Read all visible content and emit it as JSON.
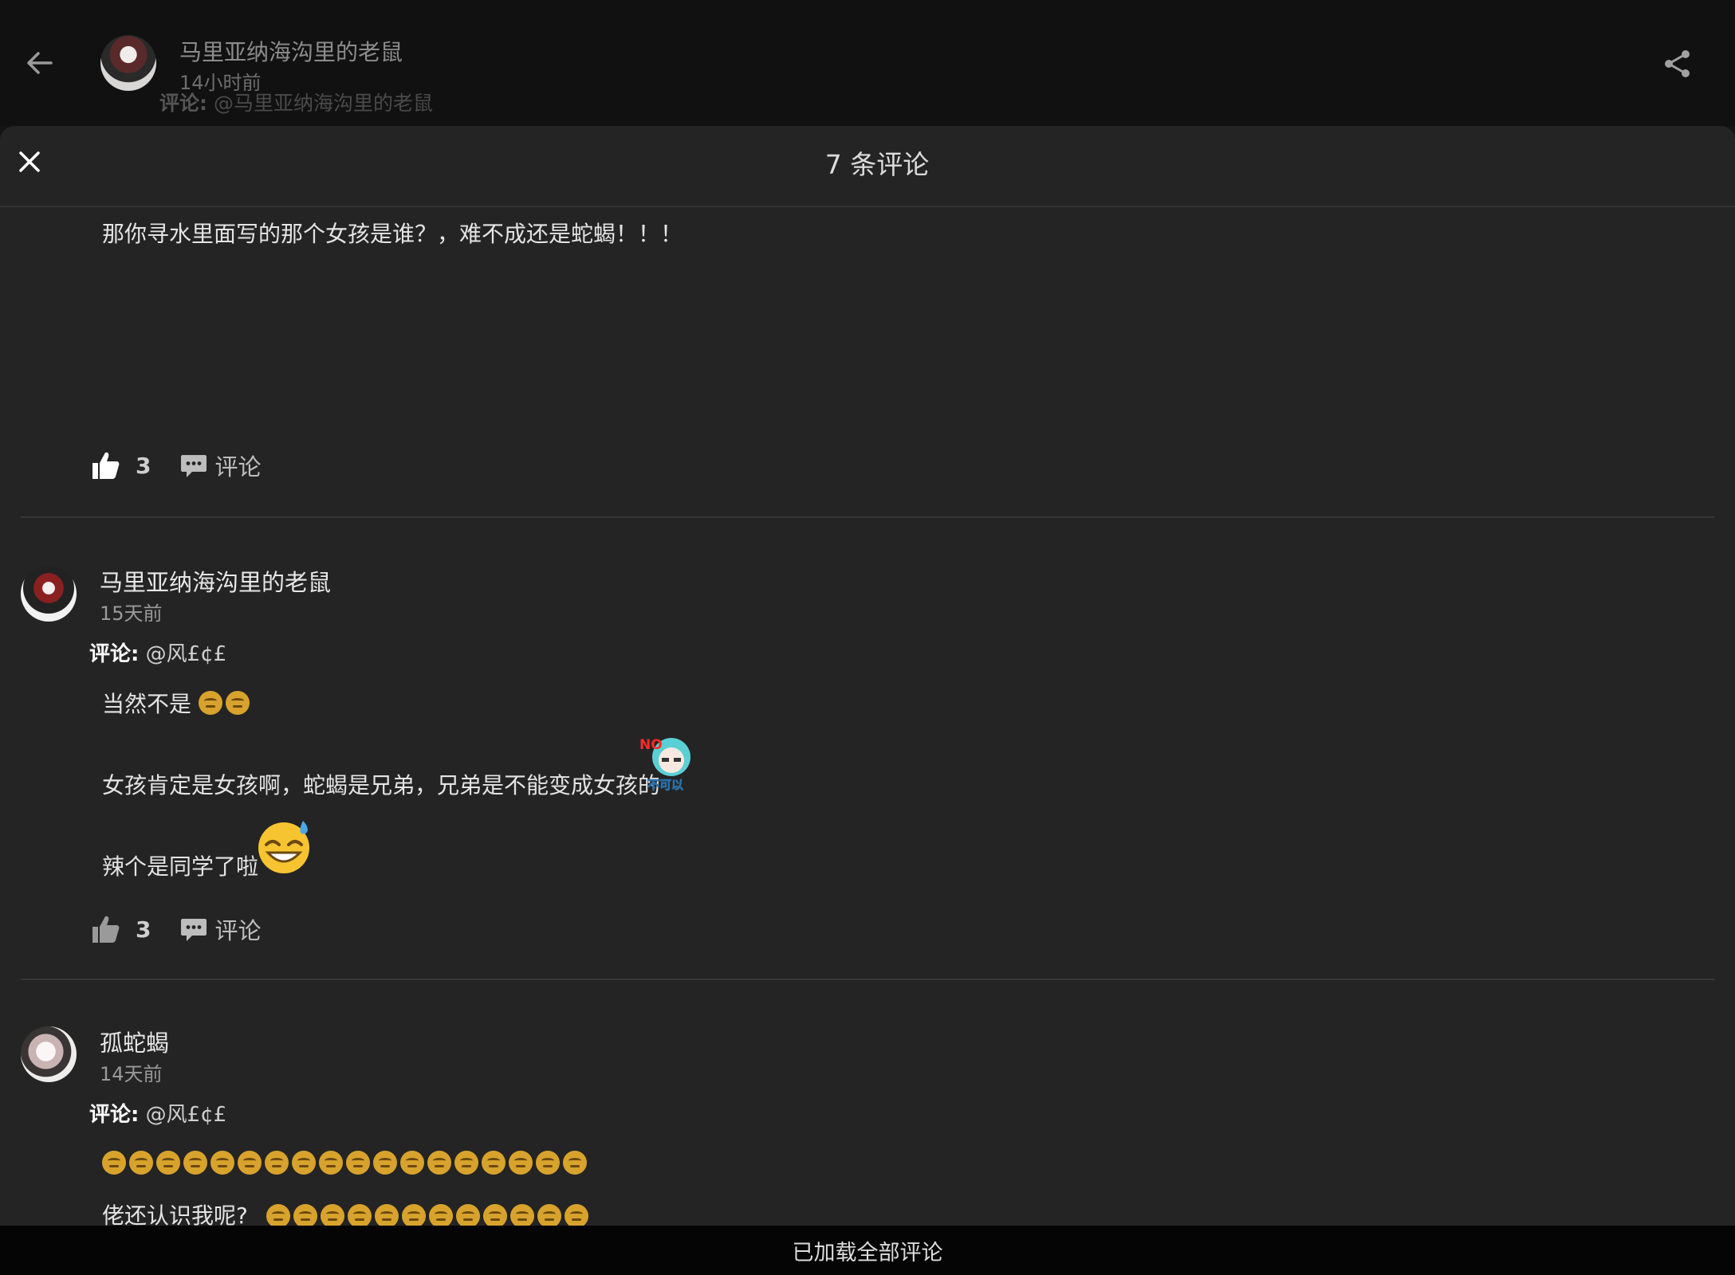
{
  "topbar": {
    "author_name": "马里亚纳海沟里的老鼠",
    "time": "14小时前",
    "sub_prefix": "评论:",
    "sub_mention": "@马里亚纳海沟里的老鼠"
  },
  "sheet": {
    "title": "7 条评论"
  },
  "comment1": {
    "text": "那你寻水里面写的那个女孩是谁？，难不成还是蛇蝎！！！",
    "likes": "3",
    "reply_label": "评论"
  },
  "comment2": {
    "author": "马里亚纳海沟里的老鼠",
    "time": "15天前",
    "reply_prefix": "评论:",
    "reply_mention": "@风£¢£",
    "line1": "当然不是",
    "line2": "女孩肯定是女孩啊，蛇蝎是兄弟，兄弟是不能变成女孩的",
    "line3": "辣个是同学了啦",
    "sticker_no": "NO",
    "sticker_text": "不可以",
    "likes": "3",
    "reply_label": "评论"
  },
  "comment3": {
    "author": "孤蛇蝎",
    "time": "14天前",
    "reply_prefix": "评论:",
    "reply_mention": "@风£¢£",
    "line2": "佬还认识我呢?"
  },
  "footer": {
    "text": "已加载全部评论"
  },
  "icons": {
    "back": "arrow-left-icon",
    "share": "share-icon",
    "close": "close-icon",
    "like": "thumbs-up-icon",
    "reply": "comment-bubble-icon"
  }
}
